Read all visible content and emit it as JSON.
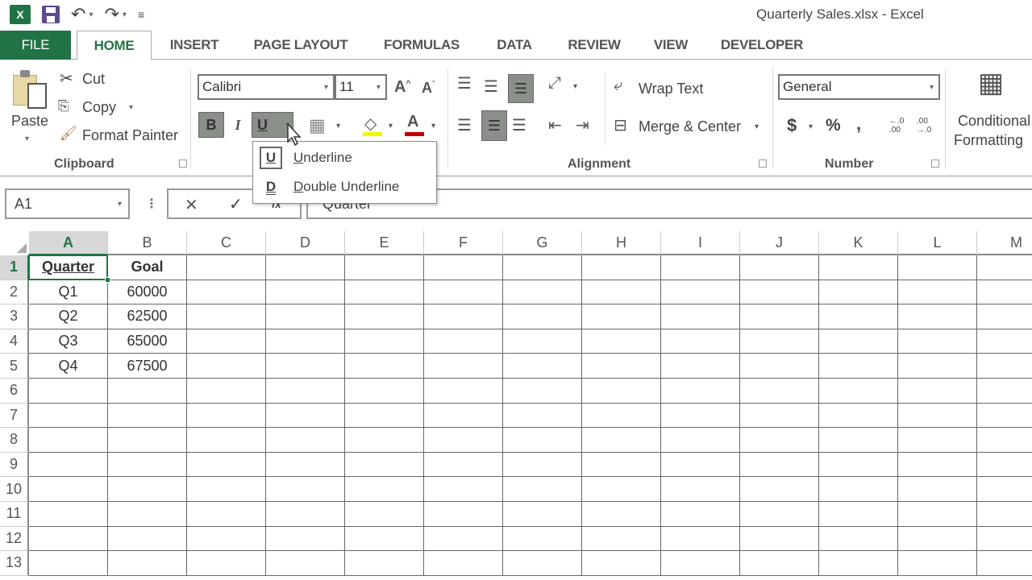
{
  "window": {
    "title": "Quarterly Sales.xlsx - Excel",
    "app_icon": "excel-icon"
  },
  "quick_access": {
    "save": "save-icon",
    "undo": "↶",
    "redo": "↷",
    "customize": "⩮"
  },
  "tabs": [
    {
      "label": "FILE"
    },
    {
      "label": "HOME",
      "active": true
    },
    {
      "label": "INSERT"
    },
    {
      "label": "PAGE LAYOUT"
    },
    {
      "label": "FORMULAS"
    },
    {
      "label": "DATA"
    },
    {
      "label": "REVIEW"
    },
    {
      "label": "VIEW"
    },
    {
      "label": "DEVELOPER"
    }
  ],
  "ribbon": {
    "clipboard": {
      "label": "Clipboard",
      "paste": "Paste",
      "cut": "Cut",
      "copy": "Copy",
      "format_painter": "Format Painter"
    },
    "font": {
      "font_name": "Calibri",
      "font_size": "11",
      "bold": "B",
      "italic": "I",
      "underline": "U",
      "grow": "A",
      "shrink": "A",
      "font_color_letter": "A",
      "fill_color": "#f5f500",
      "font_color": "#c00000"
    },
    "alignment": {
      "label": "Alignment",
      "wrap_text": "Wrap Text",
      "merge_center": "Merge & Center"
    },
    "number": {
      "label": "Number",
      "format": "General",
      "currency": "$",
      "percent": "%",
      "comma": ",",
      "inc_decimal": "←.0 .00",
      "dec_decimal": ".00 →.0"
    },
    "styles": {
      "conditional_formatting_line1": "Conditional",
      "conditional_formatting_line2": "Formatting"
    }
  },
  "underline_menu": {
    "items": [
      {
        "icon_letter": "U",
        "accel": "U",
        "rest": "nderline"
      },
      {
        "icon_letter": "D",
        "accel": "D",
        "rest": "ouble Underline"
      }
    ]
  },
  "formula_bar": {
    "name_box": "A1",
    "cancel": "✕",
    "enter": "✓",
    "fx": "fx",
    "content": "Quarter"
  },
  "sheet": {
    "columns": [
      "A",
      "B",
      "C",
      "D",
      "E",
      "F",
      "G",
      "H",
      "I",
      "J",
      "K",
      "L",
      "M"
    ],
    "rows": [
      "1",
      "2",
      "3",
      "4",
      "5",
      "6",
      "7",
      "8",
      "9",
      "10",
      "11",
      "12",
      "13"
    ],
    "cells": [
      [
        "Quarter",
        "Goal"
      ],
      [
        "Q1",
        "60000"
      ],
      [
        "Q2",
        "62500"
      ],
      [
        "Q3",
        "65000"
      ],
      [
        "Q4",
        "67500"
      ]
    ],
    "active_cell": "A1",
    "accent": "#217346"
  }
}
